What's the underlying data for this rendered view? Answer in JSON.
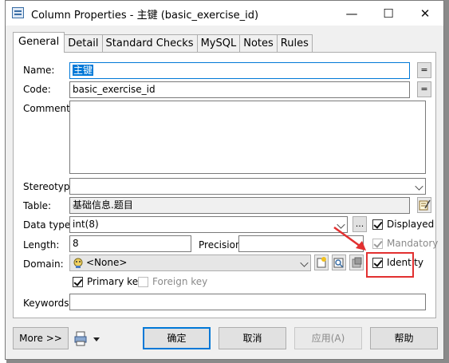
{
  "window": {
    "title": "Column Properties - 主键 (basic_exercise_id)",
    "minimize_glyph": "—",
    "maximize_glyph": "☐",
    "close_glyph": "✕"
  },
  "tabs": [
    "General",
    "Detail",
    "Standard Checks",
    "MySQL",
    "Notes",
    "Rules"
  ],
  "form": {
    "name_label": "Name:",
    "name_value": "主键",
    "code_label": "Code:",
    "code_value": "basic_exercise_id",
    "equals_label": "=",
    "comment_label": "Comment:",
    "comment_value": "",
    "stereotype_label": "Stereotype:",
    "stereotype_value": "",
    "table_label": "Table:",
    "table_value": "基础信息.题目",
    "datatype_label": "Data type:",
    "datatype_value": "int(8)",
    "ellipsis_label": "...",
    "length_label": "Length:",
    "length_value": "8",
    "precision_label": "Precision:",
    "precision_value": "",
    "domain_label": "Domain:",
    "domain_value": "<None>",
    "keywords_label": "Keywords:",
    "keywords_value": "",
    "displayed_label": "Displayed",
    "mandatory_label": "Mandatory",
    "identity_label": "Identity",
    "primary_key_label": "Primary key",
    "foreign_key_label": "Foreign key"
  },
  "checkboxes": {
    "displayed": true,
    "mandatory": true,
    "identity": true,
    "primary_key": true,
    "foreign_key": false
  },
  "buttons": {
    "more": "More >>",
    "ok": "确定",
    "cancel": "取消",
    "apply": "应用(A)",
    "help": "帮助"
  },
  "colors": {
    "accent": "#0078d7",
    "highlight_box": "#e23030",
    "annotation_arrow": "#e23030"
  },
  "icons": [
    "column-properties-icon",
    "domain-icon",
    "new-domain-icon",
    "properties-icon",
    "browse-icon",
    "print-icon",
    "edit-icon"
  ]
}
